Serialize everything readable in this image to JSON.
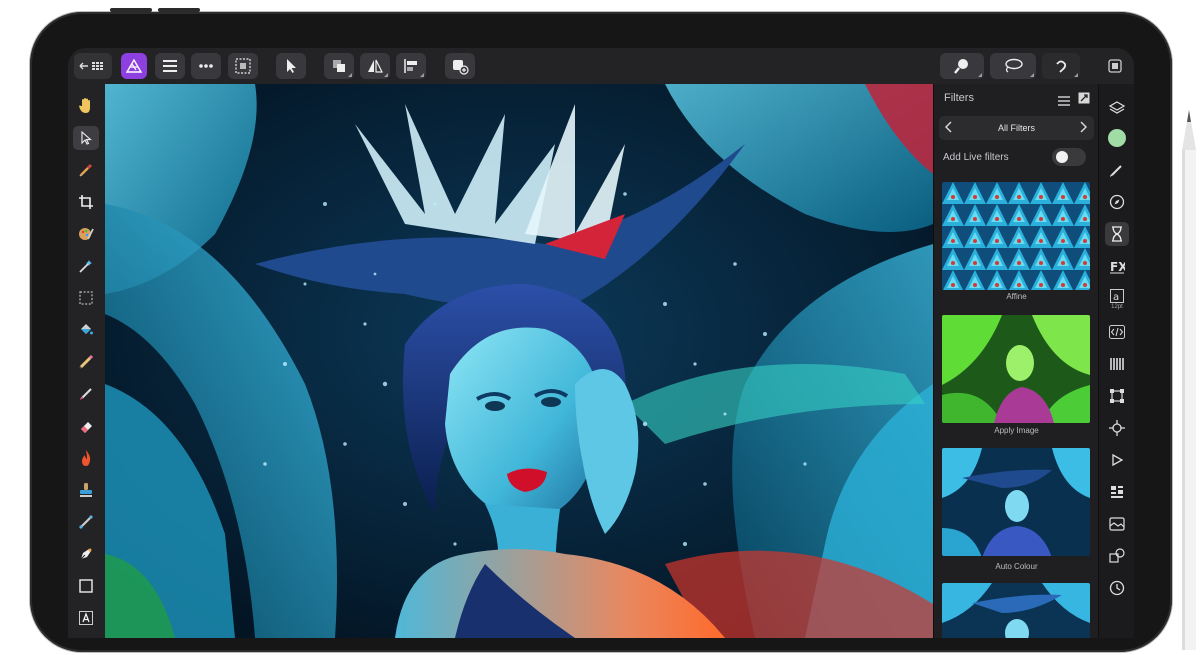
{
  "colors": {
    "accent": "#8e3fe0",
    "toolbar_bg": "#232325",
    "panel_bg": "#1f1f21",
    "canvas_teal": "#19a8d6",
    "swatch_green": "#9fdca6"
  },
  "toolbar": {
    "back_icon": "back-grid-icon",
    "persona_icon": "photo-persona-icon",
    "menu_icon": "hamburger-menu-icon",
    "more_icon": "more-options-icon",
    "selection_icon": "selection-icon",
    "move_icon": "move-tool-icon",
    "arrange_icon": "arrange-icon",
    "flip_icon": "flip-icon",
    "align_icon": "align-icon",
    "add_layer_icon": "add-layer-icon",
    "zoom_icon": "zoom-icon",
    "lasso_icon": "lasso-icon",
    "undo_icon": "undo-icon",
    "export_icon": "export-icon"
  },
  "panel": {
    "title": "Filters",
    "category": "All Filters",
    "live_filters_label": "Add Live filters",
    "live_filters_on": false,
    "filters": [
      {
        "label": "Affine"
      },
      {
        "label": "Apply Image"
      },
      {
        "label": "Auto Colour"
      },
      {
        "label": ""
      }
    ]
  },
  "studio": {
    "text_style_caption": "12pt"
  },
  "tools": [
    "hand-tool",
    "move-tool",
    "color-picker-tool",
    "crop-tool",
    "paint-brush-tool",
    "magic-wand-tool",
    "marquee-tool",
    "flood-fill-tool",
    "pencil-tool",
    "brush-tool",
    "erase-tool",
    "burn-tool",
    "clone-tool",
    "pen-tool",
    "vector-pen-tool",
    "rectangle-tool",
    "text-tool"
  ]
}
